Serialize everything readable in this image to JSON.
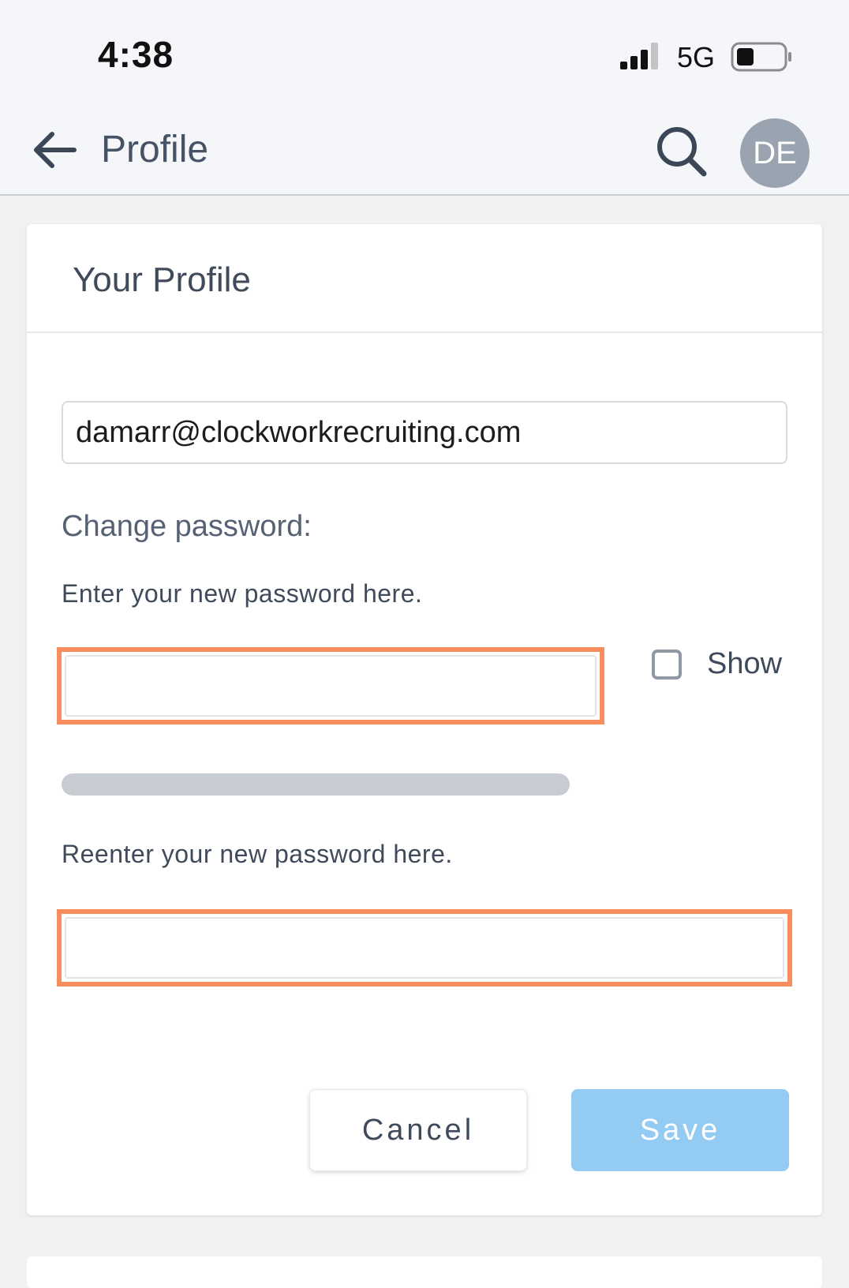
{
  "status_bar": {
    "time": "4:38",
    "network": "5G",
    "signal_icon": "cellular-signal-icon",
    "battery_icon": "battery-icon",
    "battery_level": 0.3
  },
  "app_bar": {
    "title": "Profile",
    "back_icon": "arrow-left-icon",
    "search_icon": "search-icon",
    "avatar_initials": "DE"
  },
  "profile_card": {
    "title": "Your Profile",
    "email_value": "damarr@clockworkrecruiting.com",
    "change_password_label": "Change password:",
    "new_password_label": "Enter your new password here.",
    "new_password_value": "",
    "show_label": "Show",
    "show_checked": false,
    "password_strength": 0,
    "reenter_password_label": "Reenter your new password here.",
    "reenter_password_value": "",
    "cancel_label": "Cancel",
    "save_label": "Save"
  },
  "colors": {
    "header_bg": "#f5f6f9",
    "highlight": "#f78c5c",
    "save_button": "#94cbf3",
    "avatar_bg": "#9aa4b0"
  }
}
